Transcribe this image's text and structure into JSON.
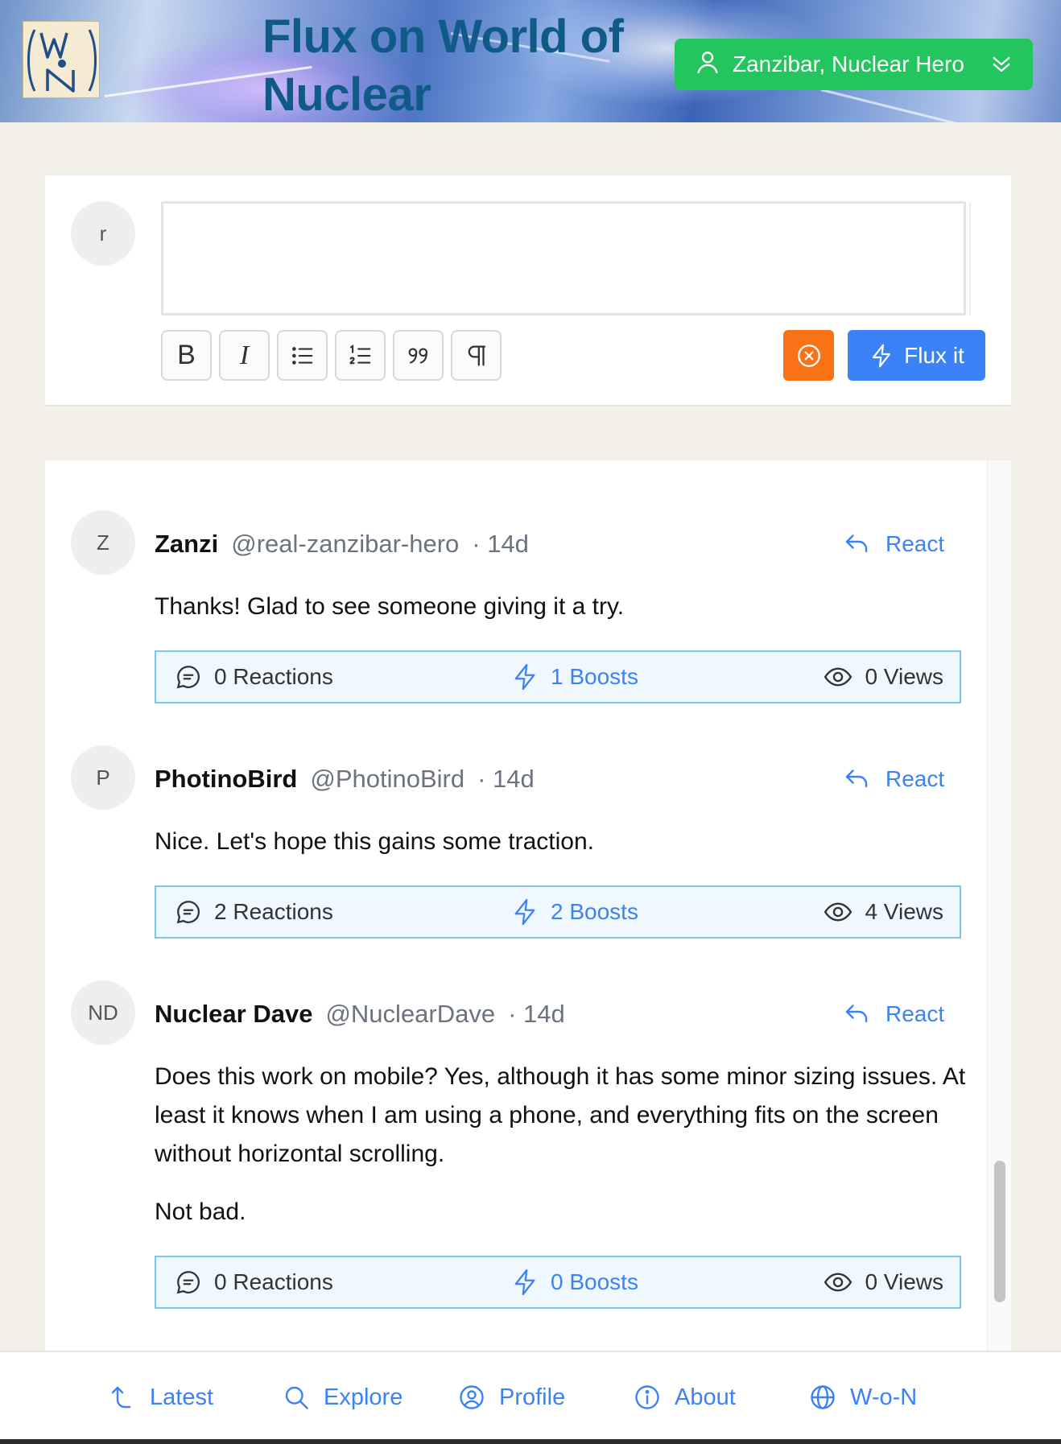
{
  "header": {
    "title": "Flux on World of Nuclear",
    "logo_letters": "WN",
    "user_label": "Zanzibar, Nuclear Hero"
  },
  "composer": {
    "avatar_initial": "r",
    "placeholder": "",
    "tools": [
      "bold",
      "italic",
      "bullet-list",
      "ordered-list",
      "blockquote",
      "paragraph"
    ],
    "bold_glyph": "B",
    "italic_glyph": "I",
    "flux_label": "Flux it"
  },
  "posts": [
    {
      "avatar": "Z",
      "name": "Zanzi",
      "handle": "@real-zanzibar-hero",
      "time": "· 14d",
      "react_label": "React",
      "body": [
        "Thanks! Glad to see someone giving it a try."
      ],
      "reactions": "0 Reactions",
      "boosts": "1 Boosts",
      "views": "0 Views"
    },
    {
      "avatar": "P",
      "name": "PhotinoBird",
      "handle": "@PhotinoBird",
      "time": "· 14d",
      "react_label": "React",
      "body": [
        "Nice. Let's hope this gains some traction."
      ],
      "reactions": "2 Reactions",
      "boosts": "2 Boosts",
      "views": "4 Views"
    },
    {
      "avatar": "ND",
      "name": "Nuclear Dave",
      "handle": "@NuclearDave",
      "time": "· 14d",
      "react_label": "React",
      "body": [
        "Does this work on mobile? Yes, although it has some minor sizing issues. At least it knows when I am using a phone, and everything fits on the screen without horizontal scrolling.",
        "Not bad."
      ],
      "reactions": "0 Reactions",
      "boosts": "0 Boosts",
      "views": "0 Views"
    }
  ],
  "nav": {
    "latest": "Latest",
    "explore": "Explore",
    "profile": "Profile",
    "about": "About",
    "won": "W-o-N"
  },
  "colors": {
    "accent_blue": "#3b82f6",
    "user_green": "#22c55e",
    "cancel_orange": "#f97316",
    "title_blue": "#0f5a86"
  }
}
